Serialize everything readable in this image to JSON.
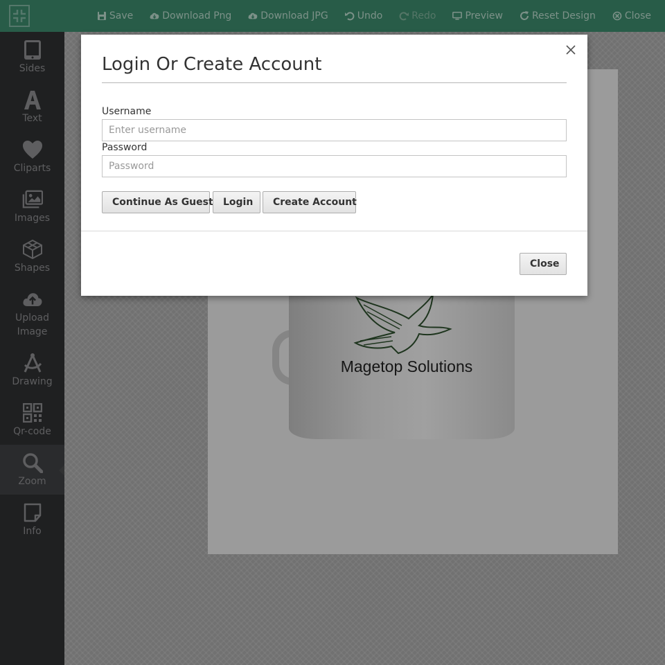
{
  "toolbar": {
    "items": [
      {
        "label": "Save",
        "icon": "save-icon"
      },
      {
        "label": "Download Png",
        "icon": "cloud-download-icon"
      },
      {
        "label": "Download JPG",
        "icon": "cloud-download-icon"
      },
      {
        "label": "Undo",
        "icon": "undo-icon"
      },
      {
        "label": "Redo",
        "icon": "redo-icon"
      },
      {
        "label": "Preview",
        "icon": "monitor-icon"
      },
      {
        "label": "Reset Design",
        "icon": "refresh-icon"
      },
      {
        "label": "Close",
        "icon": "close-circle-icon"
      }
    ],
    "color": "#3d8a6c"
  },
  "sidebar": {
    "items": [
      {
        "label": "Sides",
        "icon": "tablet-icon"
      },
      {
        "label": "Text",
        "icon": "text-icon"
      },
      {
        "label": "Cliparts",
        "icon": "heart-icon"
      },
      {
        "label": "Images",
        "icon": "images-icon"
      },
      {
        "label": "Shapes",
        "icon": "cube-icon"
      },
      {
        "label": "Upload Image",
        "icon": "cloud-upload-icon"
      },
      {
        "label": "Drawing",
        "icon": "compass-icon"
      },
      {
        "label": "Qr-code",
        "icon": "qrcode-icon"
      },
      {
        "label": "Zoom",
        "icon": "search-icon"
      },
      {
        "label": "Info",
        "icon": "note-icon"
      }
    ],
    "active": "Zoom"
  },
  "canvas": {
    "product_text": "Magetop Solutions"
  },
  "modal": {
    "title": "Login Or Create Account",
    "username_label": "Username",
    "username_placeholder": "Enter username",
    "password_label": "Password",
    "password_placeholder": "Password",
    "buttons": {
      "guest": "Continue As Guest",
      "login": "Login",
      "create": "Create Account",
      "close": "Close"
    }
  }
}
